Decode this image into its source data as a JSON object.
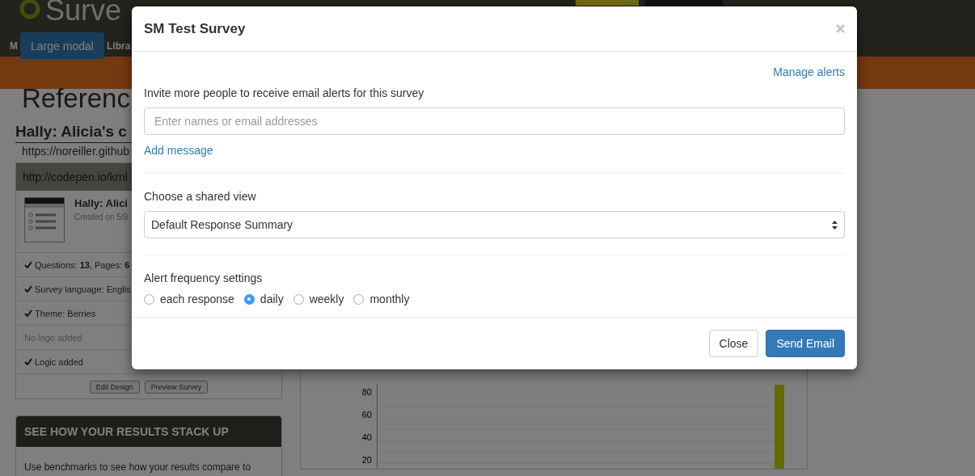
{
  "background": {
    "header": {
      "logo": "Surve",
      "nav_left": "M",
      "nav_library": "Libra",
      "large_modal_button": "Large modal"
    },
    "heading": "Referenc",
    "survey_title": "Hally: Alicia's c",
    "link": "https://noreiller.github",
    "panel": {
      "header": "http://codepen.io/krnl",
      "survey_name": "Hally: Alici",
      "created": "Created on 5/9",
      "checks": [
        {
          "text": "Questions: **13**, Pages: **6**",
          "checked": true
        },
        {
          "text": "Survey language: Englis",
          "checked": true
        },
        {
          "text": "Theme: Berries",
          "checked": true
        },
        {
          "text": "No logo added",
          "checked": false
        },
        {
          "text": "Logic added",
          "checked": true
        }
      ],
      "buttons": [
        "Edit Design",
        "Preview Survey"
      ]
    },
    "benchmark_panel": {
      "title": "SEE HOW YOUR RESULTS STACK UP",
      "text": "Use benchmarks to see how your results compare to"
    },
    "chart": {
      "y_labels": [
        "80",
        "60",
        "40",
        "20"
      ]
    }
  },
  "modal": {
    "title": "SM Test Survey",
    "manage_link": "Manage alerts",
    "invite_label": "Invite more people to receive email alerts for this survey",
    "invite_placeholder": "Enter names or email addresses",
    "add_message": "Add message",
    "view_label": "Choose a shared view",
    "view_value": "Default Response Summary",
    "frequency_label": "Alert frequency settings",
    "frequency_options": [
      {
        "label": "each response",
        "selected": false
      },
      {
        "label": "daily",
        "selected": true
      },
      {
        "label": "weekly",
        "selected": false
      },
      {
        "label": "monthly",
        "selected": false
      }
    ],
    "buttons": [
      {
        "label": "Close",
        "kind": "default"
      },
      {
        "label": "Send Email",
        "kind": "primary"
      }
    ]
  }
}
